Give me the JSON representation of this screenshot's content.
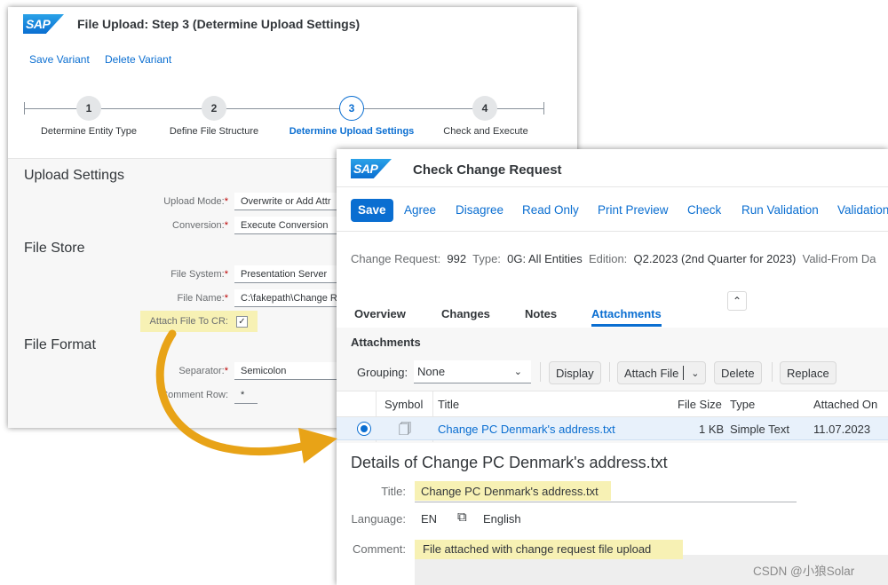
{
  "brand": {
    "logo_text": "SAP"
  },
  "upload_window": {
    "title": "File Upload: Step 3  (Determine Upload Settings)",
    "links": [
      "Save Variant",
      "Delete Variant"
    ],
    "steps": [
      {
        "number": "1",
        "label": "Determine Entity Type",
        "active": false
      },
      {
        "number": "2",
        "label": "Define File Structure",
        "active": false
      },
      {
        "number": "3",
        "label": "Determine Upload Settings",
        "active": true
      },
      {
        "number": "4",
        "label": "Check and Execute",
        "active": false
      }
    ],
    "sections": {
      "upload_settings": "Upload Settings",
      "file_store": "File Store",
      "file_format": "File Format"
    },
    "fields": {
      "upload_mode": {
        "label": "Upload Mode:",
        "value": "Overwrite or Add Attr"
      },
      "conversion": {
        "label": "Conversion:",
        "value": "Execute Conversion"
      },
      "file_system": {
        "label": "File System:",
        "value": "Presentation Server"
      },
      "file_name": {
        "label": "File Name:",
        "value": "C:\\fakepath\\Change R"
      },
      "attach_file": {
        "label": "Attach File To CR:",
        "checked": true
      },
      "separator": {
        "label": "Separator:",
        "value": "Semicolon"
      },
      "comment_row": {
        "label": "Comment Row:",
        "value": "*"
      }
    },
    "required_mark": "*"
  },
  "cr_window": {
    "title": "Check Change Request",
    "toolbar": [
      "Save",
      "Agree",
      "Disagree",
      "Read Only",
      "Print Preview",
      "Check",
      "Run Validation",
      "Validation"
    ],
    "info": {
      "change_request_label": "Change Request:",
      "change_request": "992",
      "type_label": "Type:",
      "type": "0G: All Entities",
      "edition_label": "Edition:",
      "edition": "Q2.2023 (2nd Quarter for 2023)",
      "valid_from_label": "Valid-From Da"
    },
    "tabs": [
      "Overview",
      "Changes",
      "Notes",
      "Attachments"
    ],
    "active_tab": "Attachments",
    "attachments": {
      "heading": "Attachments",
      "grouping_label": "Grouping:",
      "grouping_value": "None",
      "buttons": [
        "Display",
        "Attach File",
        "Delete",
        "Replace"
      ],
      "columns": [
        "Symbol",
        "Title",
        "File Size",
        "Type",
        "Attached On"
      ],
      "rows": [
        {
          "title": "Change PC Denmark's address.txt",
          "size": "1 KB",
          "type": "Simple Text",
          "attached_on": "11.07.2023",
          "selected": true
        }
      ]
    },
    "details": {
      "heading": "Details of Change PC Denmark's address.txt",
      "title_label": "Title:",
      "title": "Change PC Denmark's address.txt",
      "language_label": "Language:",
      "language_code": "EN",
      "language_name": "English",
      "comment_label": "Comment:",
      "comment": "File attached with change request file upload"
    }
  },
  "highlight_color": "#f7f1b4",
  "arrow_color": "#e8a317",
  "accent_color": "#0a6ed1",
  "watermark": "CSDN @小狼Solar"
}
